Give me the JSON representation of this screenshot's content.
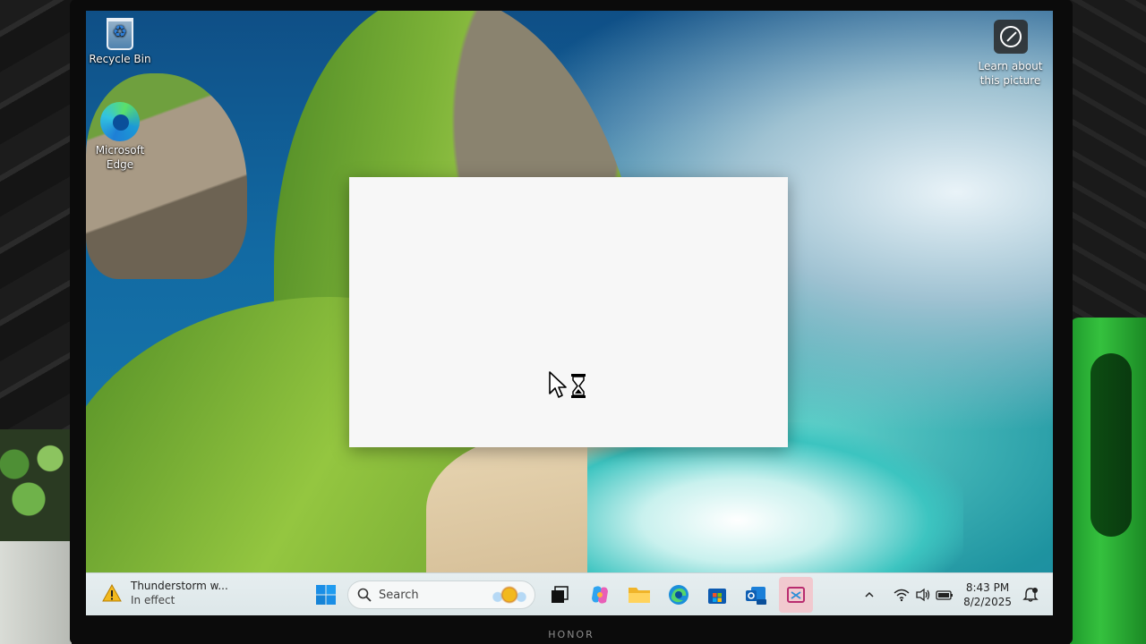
{
  "desktop": {
    "icons": [
      {
        "label": "Recycle Bin",
        "icon": "recycle-bin-icon"
      },
      {
        "label": "Microsoft Edge",
        "line1": "Microsoft",
        "line2": "Edge",
        "icon": "edge-icon"
      }
    ],
    "spotlight": {
      "line1": "Learn about",
      "line2": "this picture",
      "icon": "camera-lens-icon"
    }
  },
  "splash_window": {
    "cursor": "busy-cursor-icon"
  },
  "taskbar": {
    "weather": {
      "title": "Thunderstorm w...",
      "subtitle": "In effect",
      "icon": "weather-warning-icon"
    },
    "search_placeholder": "Search",
    "pinned": [
      {
        "name": "start",
        "icon": "windows-start-icon"
      },
      {
        "name": "task-view",
        "icon": "task-view-icon"
      },
      {
        "name": "copilot",
        "icon": "copilot-icon"
      },
      {
        "name": "file-explorer",
        "icon": "folder-icon"
      },
      {
        "name": "edge",
        "icon": "edge-icon"
      },
      {
        "name": "store",
        "icon": "microsoft-store-icon"
      },
      {
        "name": "outlook",
        "icon": "outlook-new-icon"
      },
      {
        "name": "snipping",
        "icon": "snipping-tool-icon"
      }
    ],
    "tray": {
      "time": "8:43 PM",
      "date": "8/2/2025"
    }
  },
  "device": {
    "brand": "HONOR"
  },
  "colors": {
    "taskbar": "#e3ecee",
    "splash": "#f7f7f7",
    "accent": "#0078d4"
  }
}
